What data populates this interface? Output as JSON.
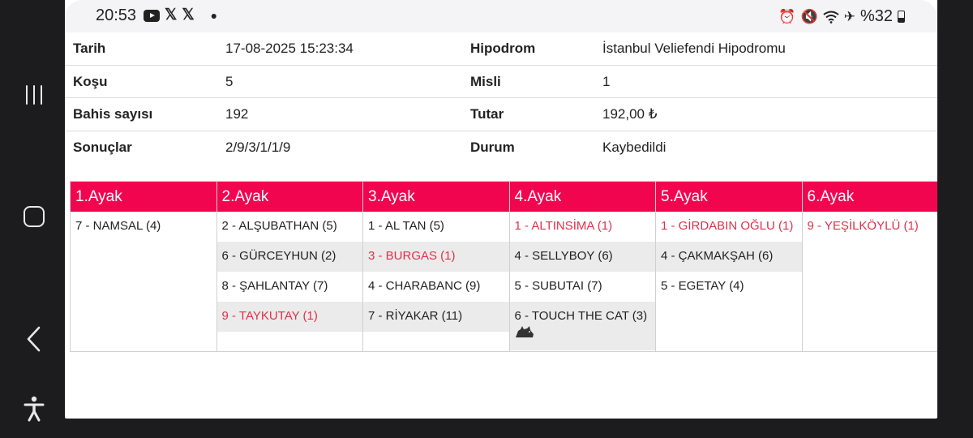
{
  "status_bar": {
    "time": "20:53",
    "left_icons": [
      "youtube-icon",
      "x-icon",
      "x-icon",
      "dot-icon"
    ],
    "right_icons": [
      "alarm-icon",
      "mute-icon",
      "wifi-icon",
      "airplane-icon"
    ],
    "battery": "%32"
  },
  "info": {
    "rows": [
      {
        "label1": "Tarih",
        "value1": "17-08-2025 15:23:34",
        "label2": "Hipodrom",
        "value2": "İstanbul Veliefendi Hipodromu"
      },
      {
        "label1": "Koşu",
        "value1": "5",
        "label2": "Misli",
        "value2": "1"
      },
      {
        "label1": "Bahis sayısı",
        "value1": "192",
        "label2": "Tutar",
        "value2": "192,00 ₺"
      },
      {
        "label1": "Sonuçlar",
        "value1": "2/9/3/1/1/9",
        "label2": "Durum",
        "value2": "Kaybedildi"
      }
    ]
  },
  "legs": [
    {
      "title": "1.Ayak",
      "horses": [
        "7 - NAMSAL (4)"
      ]
    },
    {
      "title": "2.Ayak",
      "horses": [
        "2 - ALŞUBATHAN (5)",
        "6 - GÜRCEYHUN (2)",
        "8 - ŞAHLANTAY (7)",
        "9 - TAYKUTAY (1)"
      ]
    },
    {
      "title": "3.Ayak",
      "horses": [
        "1 - AL TAN (5)",
        "3 - BURGAS (1)",
        "4 - CHARABANC (9)",
        "7 - RİYAKAR (11)"
      ]
    },
    {
      "title": "4.Ayak",
      "horses": [
        "1 - ALTINSİMA (1)",
        "4 - SELLYBOY (6)",
        "5 - SUBUTAI (7)",
        "6 - TOUCH THE CAT (3)"
      ]
    },
    {
      "title": "5.Ayak",
      "horses": [
        "1 - GİRDABIN OĞLU (1)",
        "4 - ÇAKMAKŞAH (6)",
        "5 - EGETAY (4)"
      ]
    },
    {
      "title": "6.Ayak",
      "horses": [
        "9 - YEŞİLKÖYLÜ (1)"
      ]
    }
  ],
  "colors": {
    "accent": "#f2054f",
    "winner": "#e0304a",
    "alt_row": "#ebebeb"
  }
}
